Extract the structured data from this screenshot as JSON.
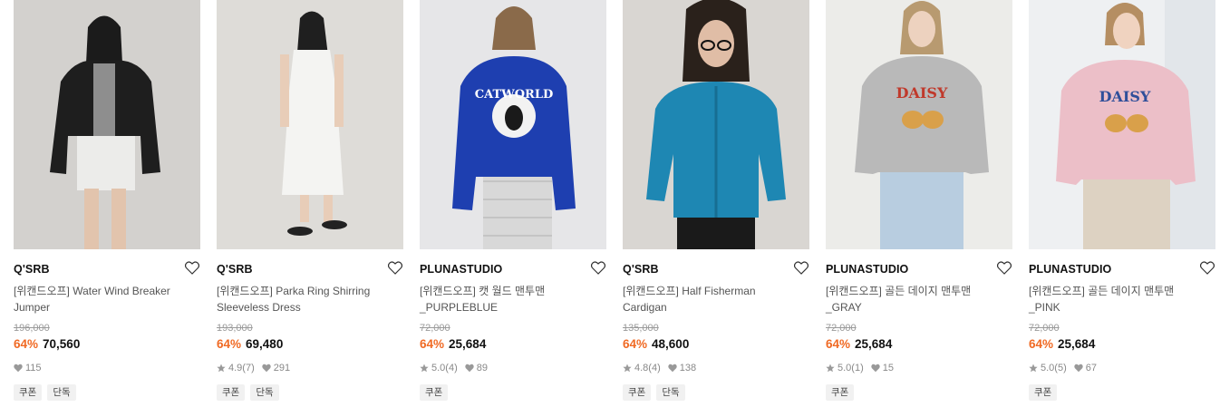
{
  "colors": {
    "discount": "#f06a24",
    "tag_bg": "#f1f1f1",
    "meta": "#888888"
  },
  "products": [
    {
      "brand": "Q'SRB",
      "name_line1": "[위캔드오프] Water Wind Breaker",
      "name_line2": "Jumper",
      "original_price": "196,000",
      "discount": "64%",
      "sale_price": "70,560",
      "rating": "",
      "reviews": "",
      "likes": "115",
      "tags": [
        "쿠폰",
        "단독"
      ],
      "image": "model in black leather jacket and grey shorts"
    },
    {
      "brand": "Q'SRB",
      "name_line1": "[위캔드오프] Parka Ring Shirring",
      "name_line2": "Sleeveless Dress",
      "original_price": "193,000",
      "discount": "64%",
      "sale_price": "69,480",
      "rating": "4.9",
      "reviews": "(7)",
      "likes": "291",
      "tags": [
        "쿠폰",
        "단독"
      ],
      "image": "model in white sleeveless dress"
    },
    {
      "brand": "PLUNASTUDIO",
      "name_line1": "[위캔드오프] 캣 월드 맨투맨",
      "name_line2": "_PURPLEBLUE",
      "original_price": "72,000",
      "discount": "64%",
      "sale_price": "25,684",
      "rating": "5.0",
      "reviews": "(4)",
      "likes": "89",
      "tags": [
        "쿠폰"
      ],
      "image": "model in blue CATWORLD sweatshirt"
    },
    {
      "brand": "Q'SRB",
      "name_line1": "[위캔드오프] Half Fisherman",
      "name_line2": "Cardigan",
      "original_price": "135,000",
      "discount": "64%",
      "sale_price": "48,600",
      "rating": "4.8",
      "reviews": "(4)",
      "likes": "138",
      "tags": [
        "쿠폰",
        "단독"
      ],
      "image": "model in teal cable knit cardigan"
    },
    {
      "brand": "PLUNASTUDIO",
      "name_line1": "[위캔드오프] 골든 데이지 맨투맨",
      "name_line2": "_GRAY",
      "original_price": "72,000",
      "discount": "64%",
      "sale_price": "25,684",
      "rating": "5.0",
      "reviews": "(1)",
      "likes": "15",
      "tags": [
        "쿠폰"
      ],
      "image": "model in grey DAISY sweatshirt"
    },
    {
      "brand": "PLUNASTUDIO",
      "name_line1": "[위캔드오프] 골든 데이지 맨투맨",
      "name_line2": "_PINK",
      "original_price": "72,000",
      "discount": "64%",
      "sale_price": "25,684",
      "rating": "5.0",
      "reviews": "(5)",
      "likes": "67",
      "tags": [
        "쿠폰"
      ],
      "image": "model in pink DAISY sweatshirt"
    }
  ],
  "image_text": {
    "p3": "CATWORLD",
    "p5": "DAISY",
    "p6": "DAISY"
  }
}
